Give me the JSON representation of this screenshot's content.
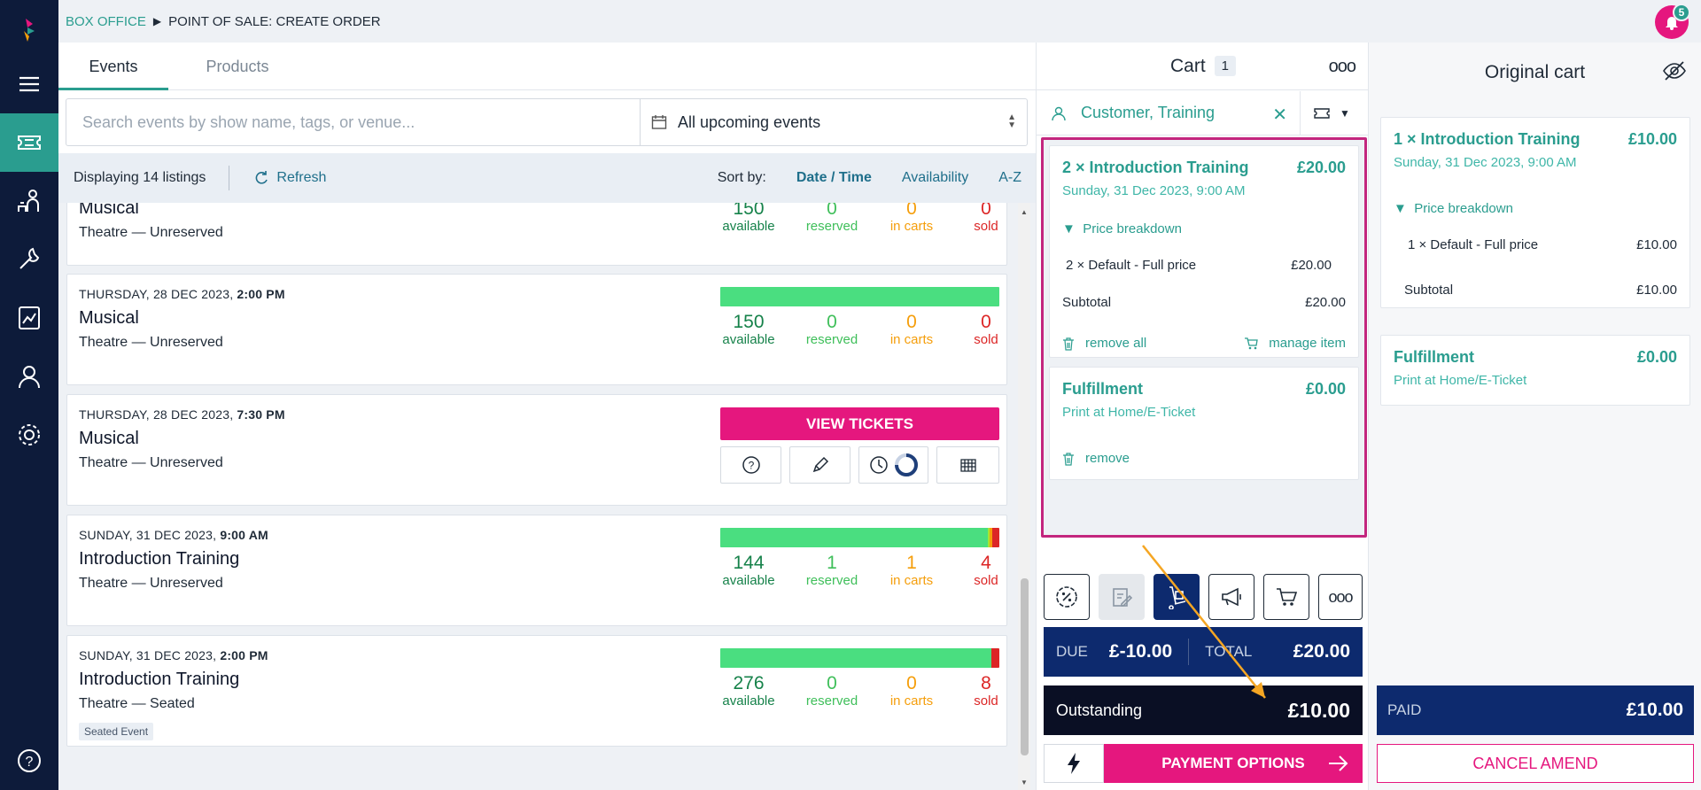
{
  "breadcrumb": {
    "section": "BOX OFFICE",
    "page": "POINT OF SALE: CREATE ORDER"
  },
  "notifications": {
    "count": "5"
  },
  "colors": {
    "brand_pink": "#e5177e",
    "teal": "#2a9d8f",
    "navy": "#0d2a6e",
    "sidebar": "#0d1b3a"
  },
  "sidebar": {
    "items": [
      {
        "icon": "logo-icon"
      },
      {
        "icon": "menu-icon"
      },
      {
        "icon": "ticket-icon",
        "active": true
      },
      {
        "icon": "people-icon"
      },
      {
        "icon": "wrench-icon"
      },
      {
        "icon": "report-icon"
      },
      {
        "icon": "user-icon"
      },
      {
        "icon": "gear-icon"
      },
      {
        "icon": "help-icon"
      }
    ]
  },
  "tabs": [
    {
      "label": "Events",
      "active": true
    },
    {
      "label": "Products",
      "active": false
    }
  ],
  "search": {
    "placeholder": "Search events by show name, tags, or venue...",
    "value": ""
  },
  "filter": {
    "selected": "All upcoming events"
  },
  "listbar": {
    "count": "Displaying 14 listings",
    "refresh": "Refresh",
    "sort_label": "Sort by:",
    "sort_options": [
      "Date / Time",
      "Availability",
      "A-Z"
    ]
  },
  "stat_labels": {
    "available": "available",
    "reserved": "reserved",
    "in_carts": "in carts",
    "sold": "sold"
  },
  "events": [
    {
      "date_day": "",
      "date_time": "",
      "name": "Musical",
      "venue": "Theatre — Unreserved",
      "available": "150",
      "reserved": "0",
      "in_carts": "0",
      "sold": "0",
      "capacity": 150,
      "partial": true
    },
    {
      "date_day": "THURSDAY, 28 DEC 2023,",
      "date_time": "2:00 PM",
      "name": "Musical",
      "venue": "Theatre — Unreserved",
      "available": "150",
      "reserved": "0",
      "in_carts": "0",
      "sold": "0",
      "capacity": 150
    },
    {
      "date_day": "THURSDAY, 28 DEC 2023,",
      "date_time": "7:30 PM",
      "name": "Musical",
      "venue": "Theatre — Unreserved",
      "view_label": "VIEW TICKETS"
    },
    {
      "date_day": "SUNDAY, 31 DEC 2023,",
      "date_time": "9:00 AM",
      "name": "Introduction Training",
      "venue": "Theatre — Unreserved",
      "available": "144",
      "reserved": "1",
      "in_carts": "1",
      "sold": "4",
      "capacity": 150
    },
    {
      "date_day": "SUNDAY, 31 DEC 2023,",
      "date_time": "2:00 PM",
      "name": "Introduction Training",
      "venue": "Theatre — Seated",
      "tag": "Seated Event",
      "available": "276",
      "reserved": "0",
      "in_carts": "0",
      "sold": "8",
      "capacity": 284
    }
  ],
  "cart": {
    "title": "Cart",
    "count": "1",
    "customer": "Customer, Training",
    "items": [
      {
        "title": "2 × Introduction Training",
        "price": "£20.00",
        "date": "Sunday, 31 Dec 2023, 9:00 AM",
        "breakdown_label": "Price breakdown",
        "lines": [
          {
            "label": "2 × Default - Full price",
            "amount": "£20.00"
          }
        ],
        "subtotal_label": "Subtotal",
        "subtotal": "£20.00",
        "remove_all": "remove all",
        "manage": "manage item"
      }
    ],
    "fulfillment": {
      "title": "Fulfillment",
      "price": "£0.00",
      "method": "Print at Home/E-Ticket",
      "remove": "remove"
    },
    "due_label": "DUE",
    "due": "£-10.00",
    "total_label": "TOTAL",
    "total": "£20.00",
    "outstanding_label": "Outstanding",
    "outstanding": "£10.00",
    "pay_label": "PAYMENT OPTIONS"
  },
  "original_cart": {
    "title": "Original cart",
    "item": {
      "title": "1 × Introduction Training",
      "price": "£10.00",
      "date": "Sunday, 31 Dec 2023, 9:00 AM",
      "breakdown_label": "Price breakdown",
      "line_label": "1 × Default - Full price",
      "line_amount": "£10.00",
      "subtotal_label": "Subtotal",
      "subtotal": "£10.00"
    },
    "fulfillment": {
      "title": "Fulfillment",
      "price": "£0.00",
      "method": "Print at Home/E-Ticket"
    },
    "paid_label": "PAID",
    "paid": "£10.00",
    "cancel_label": "CANCEL AMEND"
  }
}
